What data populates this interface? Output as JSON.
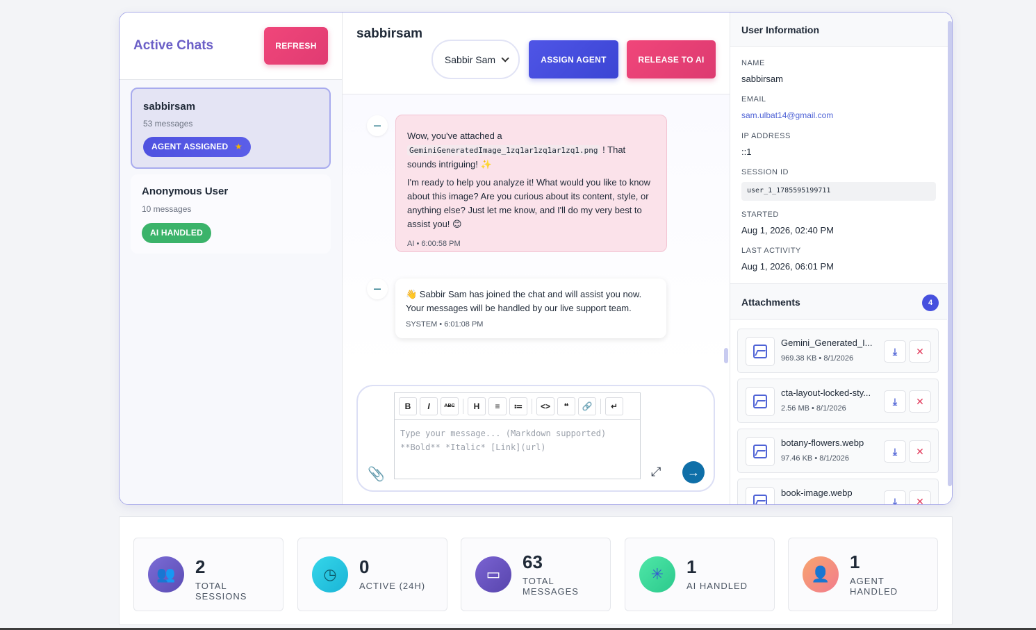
{
  "sidebar": {
    "title": "Active Chats",
    "refresh_label": "REFRESH",
    "chats": [
      {
        "name": "sabbirsam",
        "count": "53 messages",
        "badge": "AGENT ASSIGNED",
        "badge_icon": "star-icon"
      },
      {
        "name": "Anonymous User",
        "count": "10 messages",
        "badge": "AI HANDLED"
      }
    ]
  },
  "conversation": {
    "title": "sabbirsam",
    "agent_select": "Sabbir Sam",
    "assign_label": "ASSIGN AGENT",
    "release_label": "RELEASE TO AI",
    "messages": [
      {
        "p1a": "Wow, you've attached a",
        "code": "GeminiGeneratedImage_1zq1ar1zq1ar1zq1.png",
        "p1b": "! That sounds intriguing! ✨",
        "p2": "I'm ready to help you analyze it! What would you like to know about this image? Are you curious about its content, style, or anything else? Just let me know, and I'll do my very best to assist you! 😊",
        "meta": "AI • 6:00:58 PM"
      },
      {
        "text": "👋 Sabbir Sam has joined the chat and will assist you now. Your messages will be handled by our live support team.",
        "meta": "SYSTEM • 6:01:08 PM"
      }
    ],
    "composer": {
      "placeholder_line1": "Type your message... (Markdown supported)",
      "placeholder_line2": "**Bold** *Italic* [Link](url)",
      "toolbar": [
        "B",
        "I",
        "ABC",
        "H",
        "≡",
        "≔",
        "<>",
        "❝",
        "🔗",
        "↵"
      ]
    }
  },
  "user_info": {
    "header": "User Information",
    "name_label": "NAME",
    "name": "sabbirsam",
    "email_label": "EMAIL",
    "email": "sam.ulbat14@gmail.com",
    "ip_label": "IP ADDRESS",
    "ip": "::1",
    "session_label": "SESSION ID",
    "session": "user_1_1785595199711",
    "started_label": "STARTED",
    "started": "Aug 1, 2026, 02:40 PM",
    "last_label": "LAST ACTIVITY",
    "last": "Aug 1, 2026, 06:01 PM"
  },
  "attachments": {
    "header": "Attachments",
    "count": "4",
    "items": [
      {
        "name": "Gemini_Generated_I...",
        "meta": "969.38 KB • 8/1/2026"
      },
      {
        "name": "cta-layout-locked-sty...",
        "meta": "2.56 MB • 8/1/2026"
      },
      {
        "name": "botany-flowers.webp",
        "meta": "97.46 KB • 8/1/2026"
      },
      {
        "name": "book-image.webp",
        "meta": ""
      }
    ]
  },
  "stats": [
    {
      "value": "2",
      "label": "TOTAL SESSIONS",
      "icon": "users-icon",
      "color": "#6c5bc4"
    },
    {
      "value": "0",
      "label": "ACTIVE (24H)",
      "icon": "clock-icon",
      "color": "#2cc7e0"
    },
    {
      "value": "63",
      "label": "TOTAL MESSAGES",
      "icon": "message-icon",
      "color": "#6a55c2"
    },
    {
      "value": "1",
      "label": "AI HANDLED",
      "icon": "sparkle-icon",
      "color": "#38d99a"
    },
    {
      "value": "1",
      "label": "AGENT HANDLED",
      "icon": "user-icon",
      "color": "#f5917a"
    }
  ]
}
